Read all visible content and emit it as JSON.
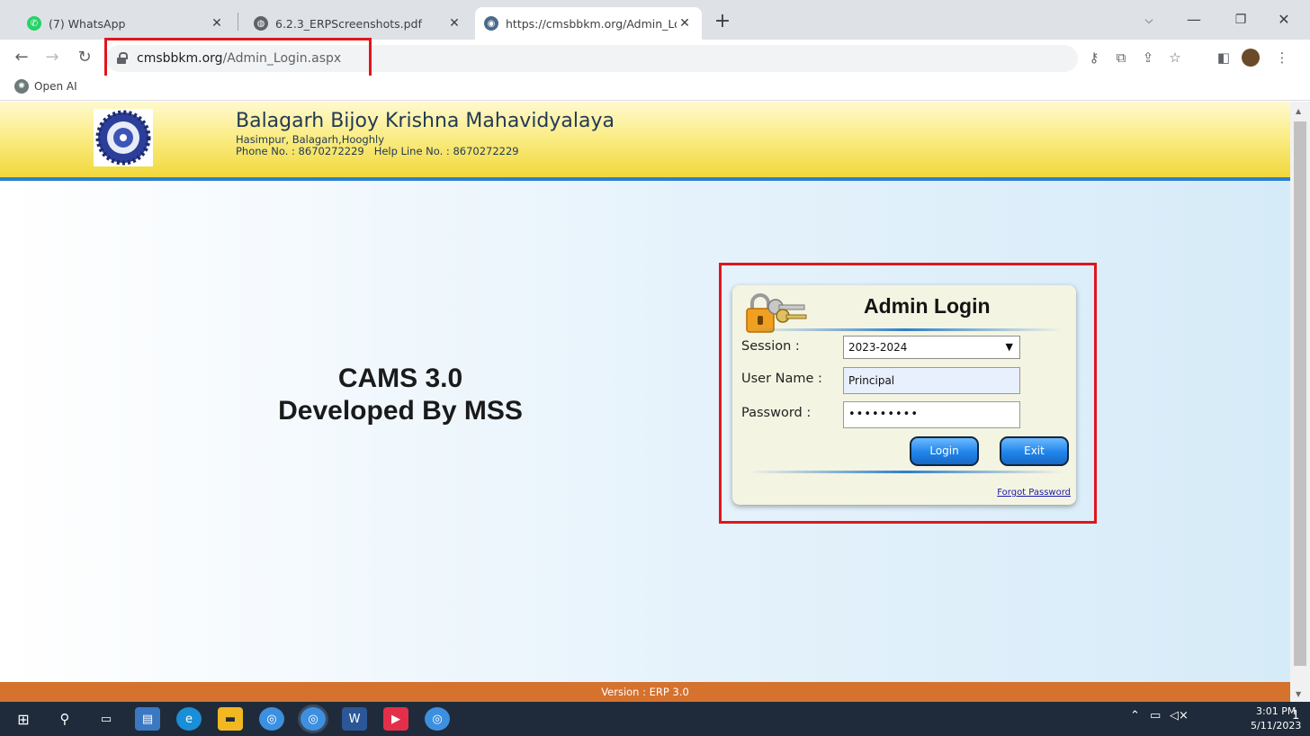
{
  "browser": {
    "tabs": [
      {
        "title": "(7) WhatsApp",
        "icon": "whatsapp-icon",
        "color": "#25d366"
      },
      {
        "title": "6.2.3_ERPScreenshots.pdf",
        "icon": "globe-icon",
        "color": "#5f6368"
      },
      {
        "title": "https://cmsbbkm.org/Admin_Log",
        "icon": "site-logo-icon",
        "color": "#4a6a8a"
      }
    ],
    "url_host": "cmsbbkm.org",
    "url_path": "/Admin_Login.aspx",
    "bookmark": "Open AI"
  },
  "header": {
    "college_name": "Balagarh Bijoy Krishna Mahavidyalaya",
    "address": "Hasimpur, Balagarh,Hooghly",
    "phone": "Phone No. : 8670272229   Help Line No. : 8670272229"
  },
  "branding": {
    "line1": "CAMS 3.0",
    "line2": "Developed By MSS"
  },
  "login": {
    "title": "Admin Login",
    "session_label": "Session :",
    "session_value": "2023-2024",
    "username_label": "User Name :",
    "username_value": "Principal",
    "password_label": "Password :",
    "password_value": "•••••••••",
    "login_button": "Login",
    "exit_button": "Exit",
    "forgot_link": "Forgot Password"
  },
  "footer": {
    "version": "Version : ERP 3.0"
  },
  "taskbar": {
    "time": "3:01 PM",
    "date": "5/11/2023",
    "notification_count": "1"
  },
  "colors": {
    "highlight_box": "#e0161e",
    "header_border": "#2f7fcc",
    "footer_bar": "#d5722e",
    "button_blue": "#1f84ea"
  }
}
